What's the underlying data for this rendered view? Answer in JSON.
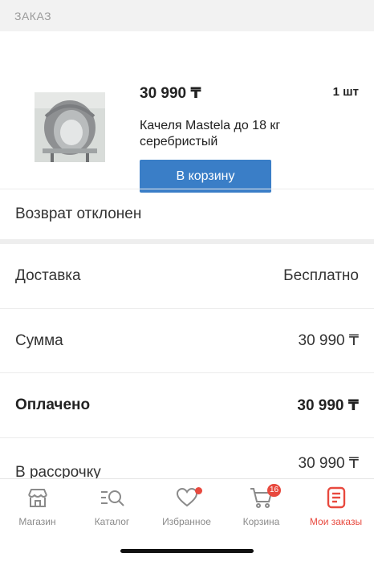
{
  "section": {
    "title": "ЗАКАЗ"
  },
  "product": {
    "price": "30 990 ₸",
    "quantity": "1 шт",
    "name": "Качеля Mastela до 18 кг серебристый",
    "cart_button": "В корзину"
  },
  "return_status": "Возврат отклонен",
  "summary": {
    "delivery_label": "Доставка",
    "delivery_value": "Бесплатно",
    "sum_label": "Сумма",
    "sum_value": "30 990 ₸",
    "paid_label": "Оплачено",
    "paid_value": "30 990 ₸",
    "installment_label": "В рассрочку",
    "installment_value": "30 990 ₸"
  },
  "tabbar": {
    "items": [
      {
        "label": "Магазин",
        "icon": "shop-icon"
      },
      {
        "label": "Каталог",
        "icon": "catalog-search-icon"
      },
      {
        "label": "Избранное",
        "icon": "heart-icon"
      },
      {
        "label": "Корзина",
        "icon": "cart-icon",
        "badge": "16"
      },
      {
        "label": "Мои заказы",
        "icon": "orders-icon"
      }
    ],
    "active": "Мои заказы"
  },
  "colors": {
    "accent": "#e8493e",
    "button": "#3a7ec7"
  }
}
